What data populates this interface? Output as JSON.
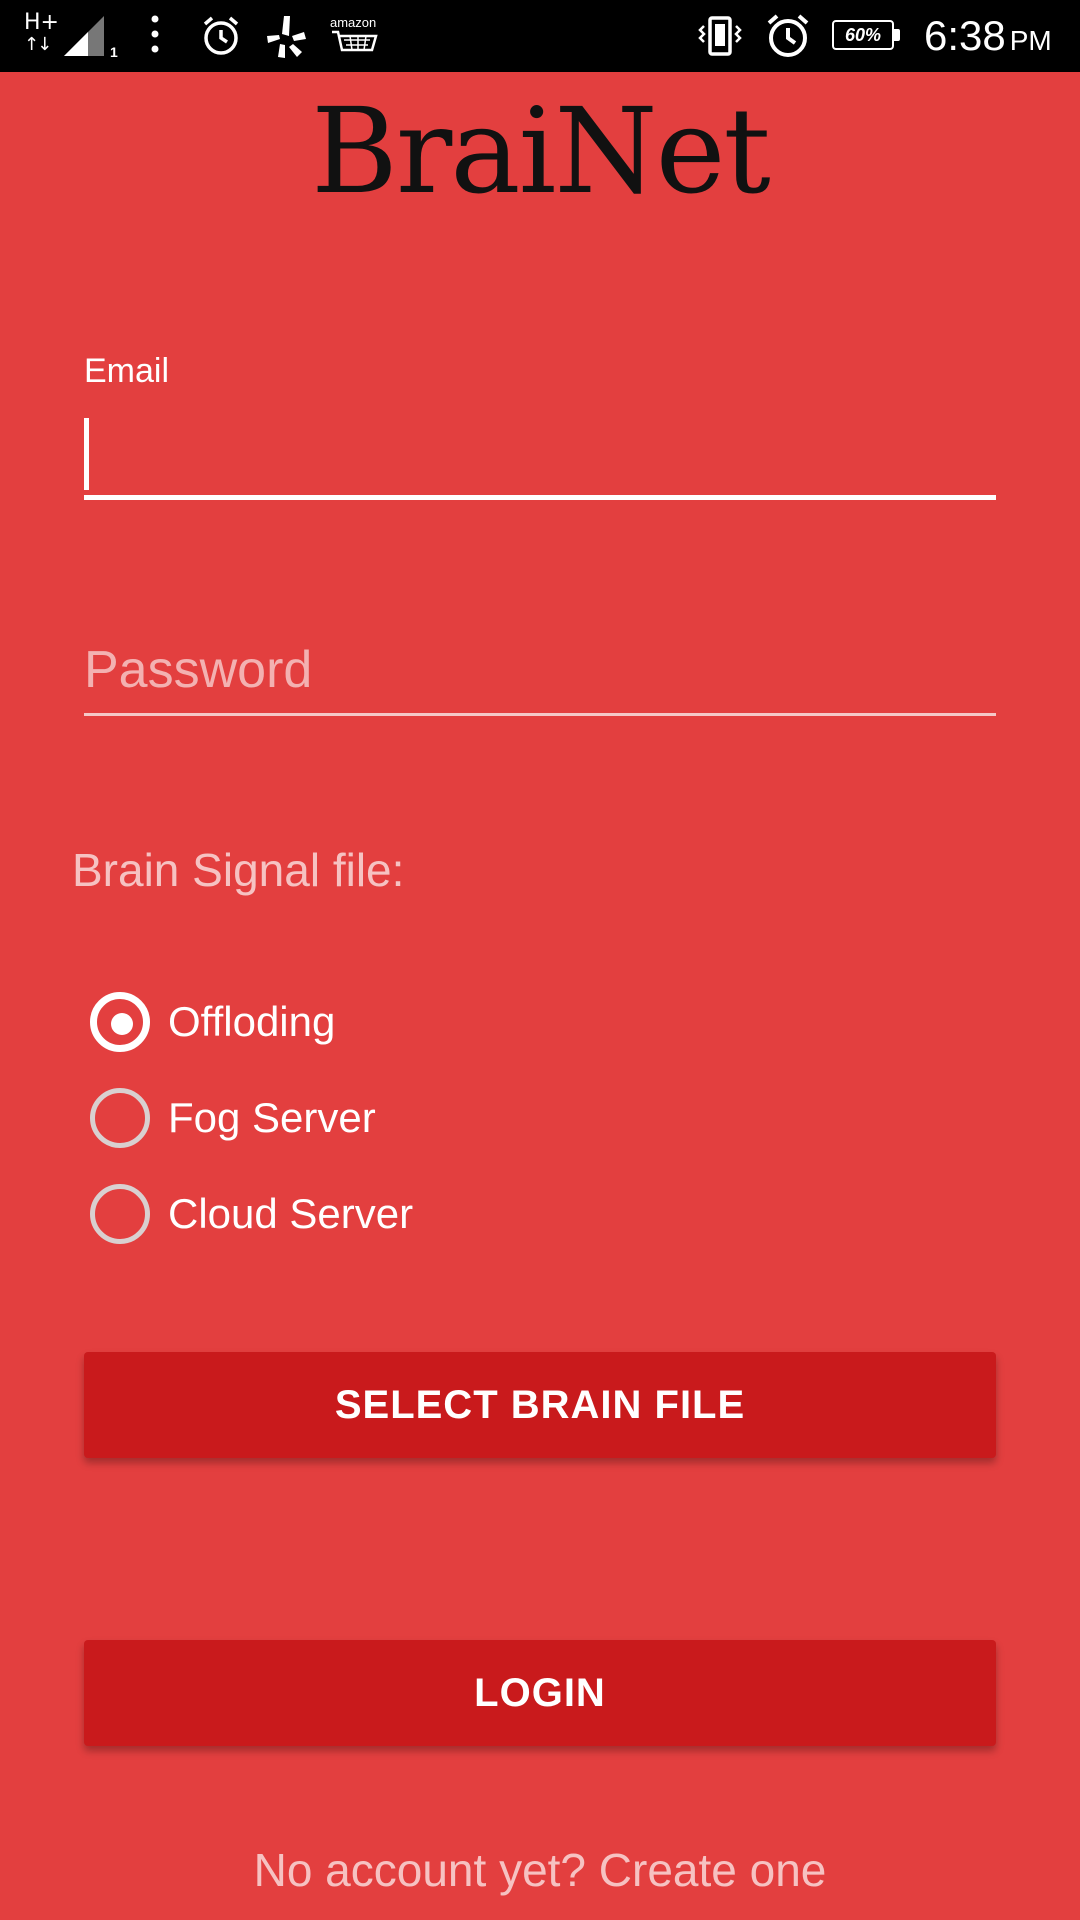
{
  "status_bar": {
    "network_type": "H+",
    "network_arrows": "↑↓",
    "sim_slot": "1",
    "amazon_label": "amazon",
    "battery_percent": "60%",
    "time": "6:38",
    "ampm": "PM",
    "icons": [
      "signal-icon",
      "overflow-menu-icon",
      "alarm-icon",
      "yelp-icon",
      "amazon-cart-icon",
      "vibrate-icon",
      "alarm-icon",
      "battery-icon"
    ]
  },
  "app": {
    "logo_text": "BraiNet"
  },
  "form": {
    "email_label": "Email",
    "email_value": "",
    "password_placeholder": "Password",
    "password_value": "",
    "brain_signal_label": "Brain Signal file:",
    "radio_options": [
      {
        "label": "Offloding",
        "checked": true
      },
      {
        "label": "Fog Server",
        "checked": false
      },
      {
        "label": "Cloud Server",
        "checked": false
      }
    ],
    "select_button_label": "SELECT BRAIN FILE",
    "login_button_label": "LOGIN",
    "signup_link_text": "No account yet? Create one"
  },
  "colors": {
    "background": "#e33f3f",
    "button": "#c91a1c",
    "status_bar": "#000000",
    "muted_text": "#f6c2c2"
  }
}
